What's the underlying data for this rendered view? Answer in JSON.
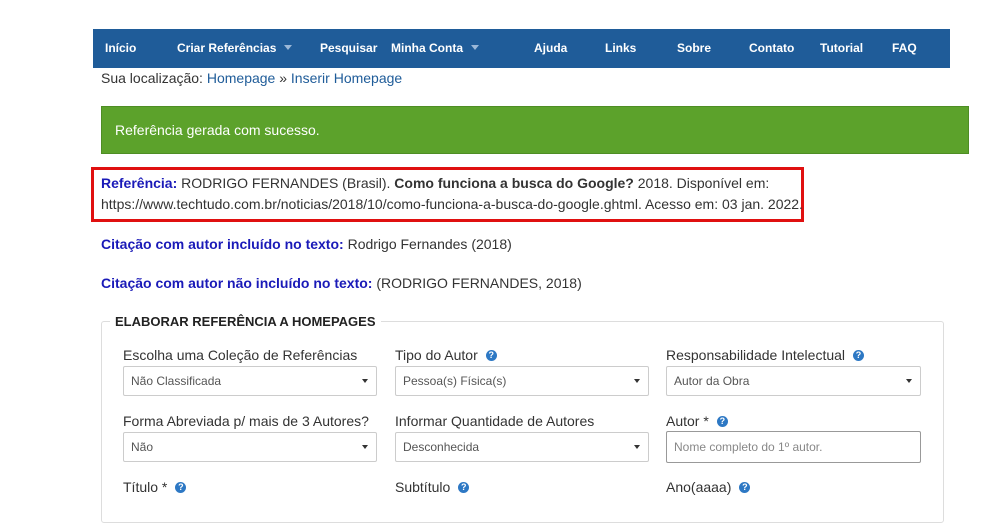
{
  "nav": {
    "items": [
      "Início",
      "Criar Referências",
      "Pesquisar",
      "Minha Conta",
      "Ajuda",
      "Links",
      "Sobre",
      "Contato",
      "Tutorial",
      "FAQ"
    ]
  },
  "breadcrumb": {
    "prefix": "Sua localização:",
    "home": "Homepage",
    "separator": "»",
    "current": "Inserir Homepage"
  },
  "alert": {
    "message": "Referência gerada com sucesso."
  },
  "reference": {
    "label": "Referência:",
    "author": "RODRIGO FERNANDES (Brasil).",
    "title": "Como funciona a busca do Google?",
    "after_title": "2018. Disponível em:",
    "line2": "https://www.techtudo.com.br/noticias/2018/10/como-funciona-a-busca-do-google.ghtml. Acesso em: 03 jan. 2022."
  },
  "citation_included": {
    "label": "Citação com autor incluído no texto:",
    "value": "Rodrigo Fernandes (2018)"
  },
  "citation_not_included": {
    "label": "Citação com autor não incluído no texto:",
    "value": "(RODRIGO FERNANDES, 2018)"
  },
  "form": {
    "legend": "ELABORAR REFERÊNCIA A HOMEPAGES",
    "help_glyph": "?",
    "colecao": {
      "label": "Escolha uma Coleção de Referências",
      "value": "Não Classificada"
    },
    "tipo_autor": {
      "label": "Tipo do Autor",
      "value": "Pessoa(s) Física(s)"
    },
    "responsabilidade": {
      "label": "Responsabilidade Intelectual",
      "value": "Autor da Obra"
    },
    "forma_abreviada": {
      "label": "Forma Abreviada p/ mais de 3 Autores?",
      "value": "Não"
    },
    "quantidade": {
      "label": "Informar Quantidade de Autores",
      "value": "Desconhecida"
    },
    "autor": {
      "label": "Autor *",
      "placeholder": "Nome completo do 1º autor."
    },
    "titulo": {
      "label": "Título *"
    },
    "subtitulo": {
      "label": "Subtítulo"
    },
    "ano": {
      "label": "Ano(aaaa)"
    }
  }
}
